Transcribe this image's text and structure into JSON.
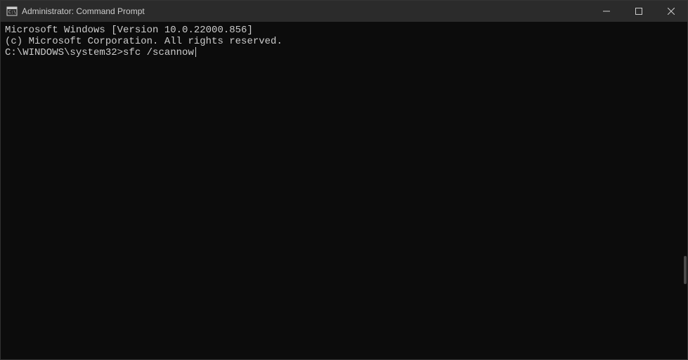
{
  "titlebar": {
    "title": "Administrator: Command Prompt"
  },
  "terminal": {
    "line1": "Microsoft Windows [Version 10.0.22000.856]",
    "line2": "(c) Microsoft Corporation. All rights reserved.",
    "blank": "",
    "prompt": "C:\\WINDOWS\\system32>",
    "command": "sfc /scannow"
  }
}
